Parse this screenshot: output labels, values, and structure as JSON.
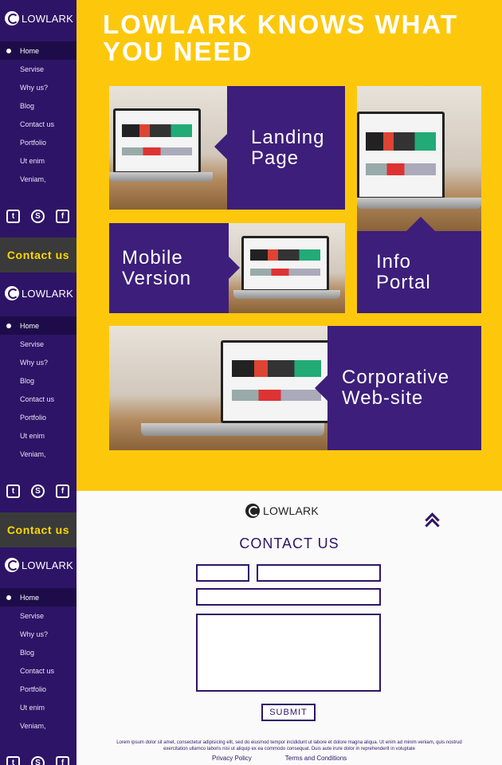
{
  "brand": {
    "logo_text": "LOWLARK"
  },
  "sidebar": {
    "menu": [
      "Home",
      "Servise",
      "Why us?",
      "Blog",
      "Contact us",
      "Portfolio",
      "Ut enim",
      "Veniam,"
    ],
    "active_index": 0,
    "social_icons": [
      "twitter-icon",
      "skype-icon",
      "facebook-icon"
    ],
    "contact_tab_label": "Contact us"
  },
  "hero": {
    "title": "LOWLARK KNOWS WHAT YOU NEED",
    "tiles": {
      "landing": "Landing\nPage",
      "mobile": "Mobile\nVersion",
      "info": "Info\nPortal",
      "corporate": "Corporative\nWeb-site"
    }
  },
  "contact": {
    "title": "CONTACT US",
    "submit_label": "SUBMIT",
    "lorem": "Lorem ipsum dolor sit amet, consectetur adipisicing elit, sed do eiusmod tempor incididunt ut labore et dolore magna aliqua. Ut enim ad minim veniam, quis nostrud exercitation ullamco laboris nisi ut aliquip ex ea commodo consequat. Duis aute irure dolor in reprehenderit in voluptate",
    "privacy": "Privacy Policy",
    "terms": "Terms and Conditions"
  },
  "colors": {
    "purple": "#3d1e7a",
    "yellow": "#fdc80c",
    "sidebar": "#2e1466",
    "contact_tab_text": "#ffd800"
  }
}
